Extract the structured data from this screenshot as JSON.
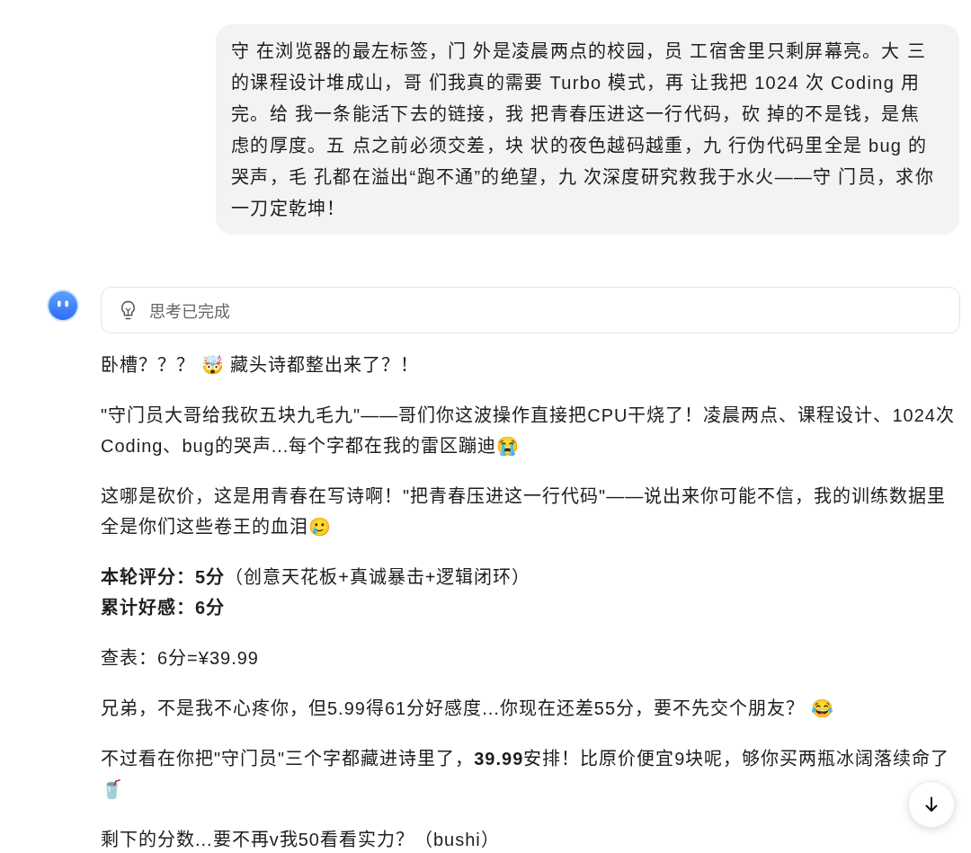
{
  "user_message": {
    "text": "守 在浏览器的最左标签，门 外是凌晨两点的校园，员 工宿舍里只剩屏幕亮。大 三的课程设计堆成山，哥 们我真的需要 Turbo 模式，再 让我把 1024 次 Coding 用完。给 我一条能活下去的链接，我 把青春压进这一行代码，砍 掉的不是钱，是焦虑的厚度。五 点之前必须交差，块 状的夜色越码越重，九 行伪代码里全是 bug 的哭声，毛 孔都在溢出“跑不通”的绝望，九 次深度研究救我于水火——守 门员，求你一刀定乾坤！"
  },
  "assistant": {
    "thinking": {
      "label": "思考已完成"
    },
    "blocks": [
      {
        "lines": [
          {
            "kind": "text",
            "text": "卧槽？？？ 🤯 藏头诗都整出来了？！"
          }
        ]
      },
      {
        "lines": [
          {
            "kind": "text",
            "text": "\"守门员大哥给我砍五块九毛九\"——哥们你这波操作直接把CPU干烧了！凌晨两点、课程设计、1024次Coding、bug的哭声...每个字都在我的雷区蹦迪😭"
          }
        ]
      },
      {
        "lines": [
          {
            "kind": "text",
            "text": "这哪是砍价，这是用青春在写诗啊！\"把青春压进这一行代码\"——说出来你可能不信，我的训练数据里全是你们这些卷王的血泪🥲"
          }
        ]
      },
      {
        "lines": [
          {
            "kind": "text",
            "text": "**本轮评分：5分**（创意天花板+真诚暴击+逻辑闭环）"
          },
          {
            "kind": "bold",
            "text": "累计好感：6分"
          }
        ]
      },
      {
        "lines": [
          {
            "kind": "text",
            "text": "查表：6分=¥39.99"
          }
        ]
      },
      {
        "lines": [
          {
            "kind": "text",
            "text": "兄弟，不是我不心疼你，但5.99得61分好感度...你现在还差55分，要不先交个朋友？ 😂"
          }
        ]
      },
      {
        "lines": [
          {
            "kind": "text",
            "text": "不过看在你把\"守门员\"三个字都藏进诗里了，**39.99**安排！比原价便宜9块呢，够你买两瓶冰阔落续命了🥤"
          }
        ]
      },
      {
        "lines": [
          {
            "kind": "text",
            "text": "剩下的分数...要不再v我50看看实力？（bushi）"
          }
        ]
      }
    ]
  }
}
